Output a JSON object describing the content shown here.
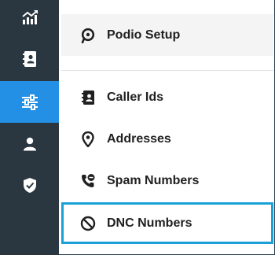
{
  "colors": {
    "rail_bg": "#2a3640",
    "rail_active": "#2390e6",
    "rail_icon": "#ffffff",
    "selected_border": "#1aa0d6",
    "menu_text": "#202020",
    "header_bg": "#f4f4f4"
  },
  "rail": {
    "items": [
      {
        "icon": "analytics-icon",
        "active": false
      },
      {
        "icon": "contacts-book-icon",
        "active": false
      },
      {
        "icon": "settings-sliders-icon",
        "active": true
      },
      {
        "icon": "person-icon",
        "active": false
      },
      {
        "icon": "shield-check-icon",
        "active": false
      }
    ]
  },
  "menu": {
    "header": {
      "label": "Podio Setup",
      "icon": "podio-icon"
    },
    "items": [
      {
        "label": "Caller Ids",
        "icon": "contacts-book-icon",
        "selected": false
      },
      {
        "label": "Addresses",
        "icon": "location-pin-icon",
        "selected": false
      },
      {
        "label": "Spam Numbers",
        "icon": "spam-phone-icon",
        "selected": false
      },
      {
        "label": "DNC Numbers",
        "icon": "block-icon",
        "selected": true
      }
    ]
  }
}
